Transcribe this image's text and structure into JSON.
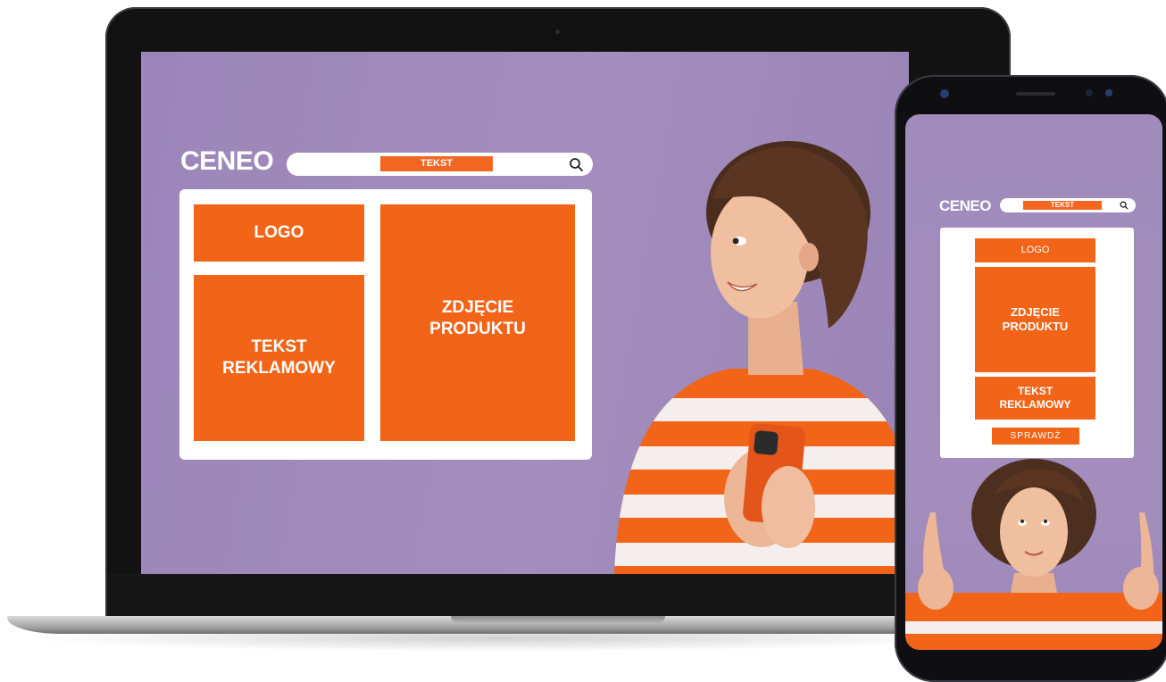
{
  "laptop_ad": {
    "brand": "CENEO",
    "search_tag": "TEKST",
    "tiles": {
      "logo": "LOGO",
      "ad_text_line1": "TEKST",
      "ad_text_line2": "REKLAMOWY",
      "product_photo_line1": "ZDJĘCIE",
      "product_photo_line2": "PRODUKTU"
    }
  },
  "phone_ad": {
    "brand": "CENEO",
    "search_tag": "TEKST",
    "tiles": {
      "logo": "LOGO",
      "product_photo_line1": "ZDJĘCIE",
      "product_photo_line2": "PRODUKTU",
      "ad_text_line1": "TEKST",
      "ad_text_line2": "REKLAMOWY"
    },
    "cta_label": "SPRAWDŹ"
  },
  "colors": {
    "screen_background": "#a28dbd",
    "accent_orange": "#f26418",
    "panel_white": "#ffffff",
    "device_black": "#121212"
  },
  "icons": [
    "search-icon"
  ]
}
